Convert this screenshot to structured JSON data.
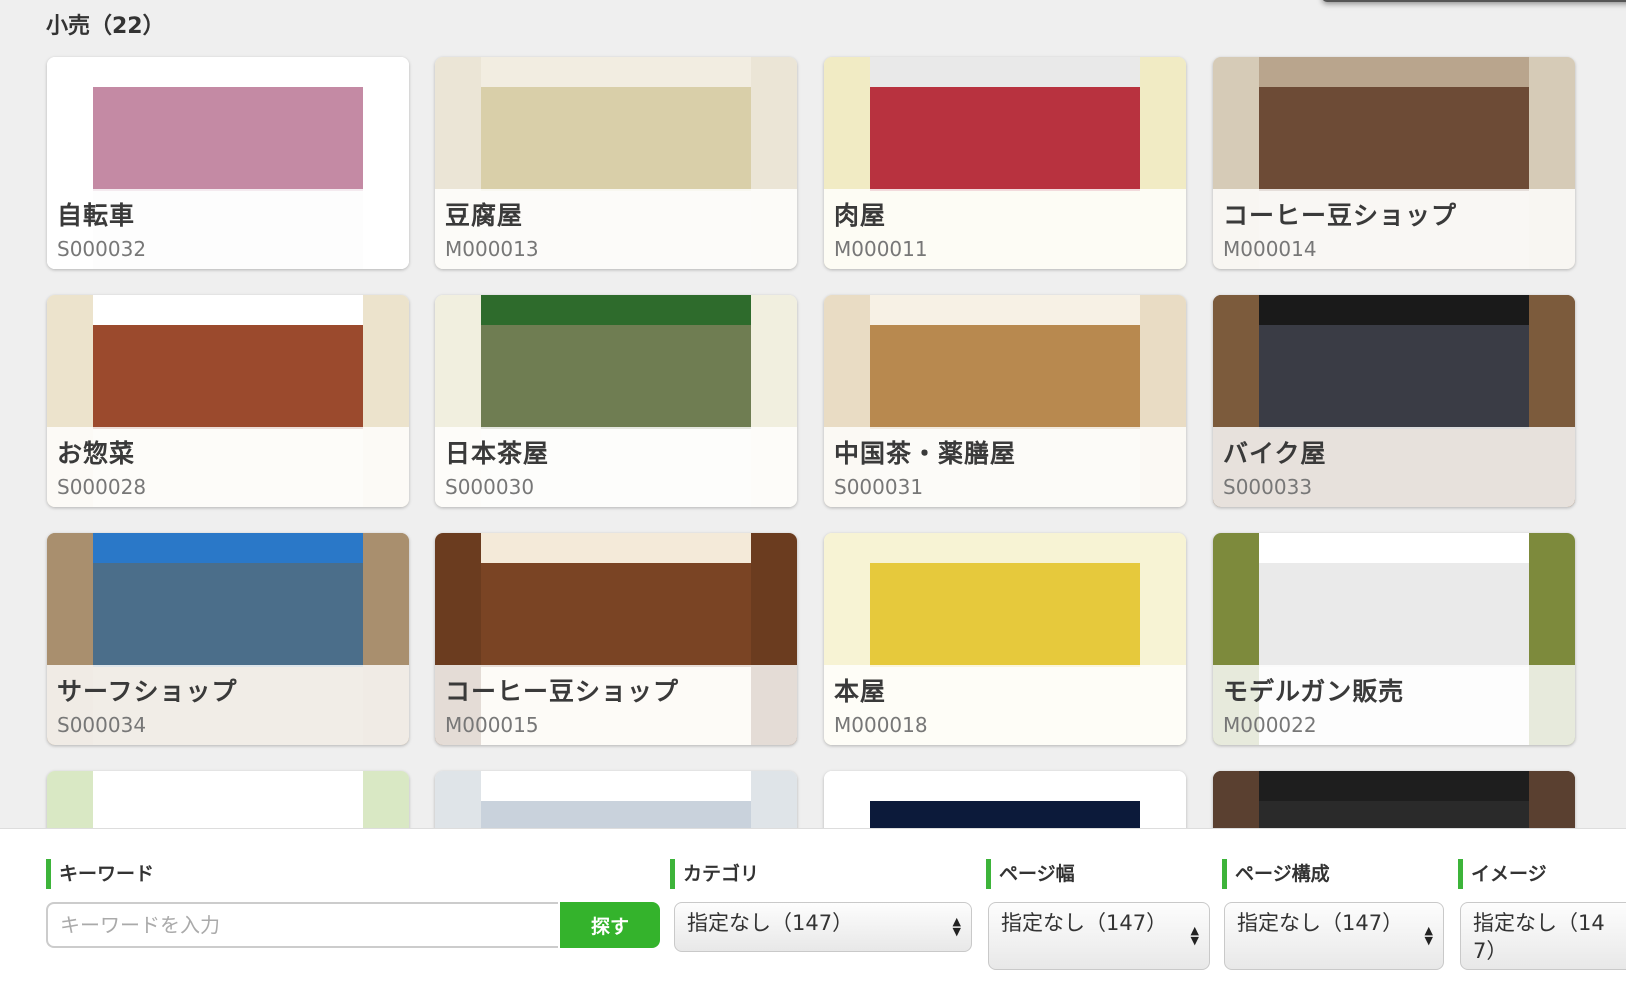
{
  "section": {
    "title": "小売（22）"
  },
  "cards": [
    {
      "name": "自転車",
      "code": "S000032",
      "bg": "#f4f4f4",
      "side": "#ffffff",
      "hdr": "#ffffff",
      "hero": "#c48aa4"
    },
    {
      "name": "豆腐屋",
      "code": "M000013",
      "bg": "#efeadf",
      "side": "#ebe5d6",
      "hdr": "#f2ede1",
      "hero": "#d9cfa9"
    },
    {
      "name": "肉屋",
      "code": "M000011",
      "bg": "#f1ecc9",
      "side": "#f1ebc4",
      "hdr": "#e9e9e9",
      "hero": "#b8323f"
    },
    {
      "name": "コーヒー豆ショップ",
      "code": "M000014",
      "bg": "#ddd4c3",
      "side": "#d6cbb7",
      "hdr": "#b9a58d",
      "hero": "#6d4b36"
    },
    {
      "name": "お惣菜",
      "code": "S000028",
      "bg": "#f2ecdc",
      "side": "#ece3cc",
      "hdr": "#ffffff",
      "hero": "#9b4a2d"
    },
    {
      "name": "日本茶屋",
      "code": "S000030",
      "bg": "#f3f1e6",
      "side": "#f1efdf",
      "hdr": "#2e6b2c",
      "hero": "#6f7d52"
    },
    {
      "name": "中国茶・薬膳屋",
      "code": "S000031",
      "bg": "#efe6d6",
      "side": "#e9dcc4",
      "hdr": "#f7f1e5",
      "hero": "#b8894f"
    },
    {
      "name": "バイク屋",
      "code": "S000033",
      "bg": "#7a5a3e",
      "side": "#7c5b3c",
      "hdr": "#1a1a1a",
      "hero": "#3a3c45"
    },
    {
      "name": "サーフショップ",
      "code": "S000034",
      "bg": "#b39b7d",
      "side": "#a98f6e",
      "hdr": "#2a78c8",
      "hero": "#4b6e8a"
    },
    {
      "name": "コーヒー豆ショップ",
      "code": "M000015",
      "bg": "#f1e6d4",
      "side": "#6b3c1f",
      "hdr": "#f4ead9",
      "hero": "#7a4424"
    },
    {
      "name": "本屋",
      "code": "M000018",
      "bg": "#f7f3d4",
      "side": "#f7f3d4",
      "hdr": "#f7f3d4",
      "hero": "#e6c93c"
    },
    {
      "name": "モデルガン販売",
      "code": "M000022",
      "bg": "#f2f2f2",
      "side": "#7d8a3c",
      "hdr": "#ffffff",
      "hero": "#eaeaea"
    },
    {
      "name": "",
      "code": "",
      "bg": "#e6f0d8",
      "side": "#d9e8c4",
      "hdr": "#ffffff",
      "hero": "#ffffff"
    },
    {
      "name": "",
      "code": "",
      "bg": "#e9ecef",
      "side": "#dfe4e8",
      "hdr": "#ffffff",
      "hero": "#c9d2dc"
    },
    {
      "name": "",
      "code": "",
      "bg": "#ffffff",
      "side": "#ffffff",
      "hdr": "#ffffff",
      "hero": "#0c1a3a"
    },
    {
      "name": "",
      "code": "",
      "bg": "#5a4030",
      "side": "#5a4030",
      "hdr": "#1e1e1e",
      "hero": "#2a2a2a"
    }
  ],
  "filters": {
    "keyword_label": "キーワード",
    "keyword_placeholder": "キーワードを入力",
    "keyword_value": "",
    "search_label": "探す",
    "category_label": "カテゴリ",
    "category_value": "指定なし（147）",
    "width_label": "ページ幅",
    "width_value": "指定なし（147）",
    "structure_label": "ページ構成",
    "structure_value": "指定なし（147）",
    "image_label": "イメージ",
    "image_value": "指定なし（147）"
  },
  "colors": {
    "accent": "#34b32c",
    "background": "#efefef"
  },
  "icons": {
    "select_arrows": "updown-arrows-icon"
  }
}
